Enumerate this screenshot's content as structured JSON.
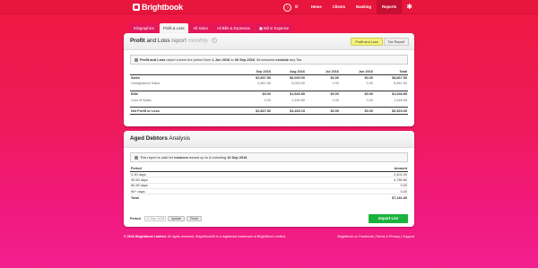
{
  "brand": {
    "name": "Brightbook"
  },
  "nav": {
    "items": [
      "Home",
      "Clients",
      "Banking",
      "Reports"
    ],
    "active": "Reports",
    "small_icon_label": "0"
  },
  "tabs": [
    {
      "label": "Infographics",
      "active": false
    },
    {
      "label": "Profit & Loss",
      "active": true
    },
    {
      "label": "All Sales",
      "active": false
    },
    {
      "label": "All Bills & Expenses",
      "active": false
    },
    {
      "label": "Bill or Expense",
      "active": false
    }
  ],
  "pl": {
    "title_bold": "Profit",
    "title_rest": " and Loss",
    "title_light": " report",
    "title_muted": " monthly",
    "btn_pl": "Profit and Loss",
    "btn_tax": "Tax Report",
    "info_pre": "Profit and Loss",
    "info_mid1": " report covers the period from ",
    "info_from": "1 Jun 2016",
    "info_mid2": " to ",
    "info_to": "30 Sep 2016",
    "info_mid3": ". All amounts ",
    "info_exclude": "exclude",
    "info_end": " any Tax.",
    "columns": [
      "Sep 2016",
      "Aug 2016",
      "Jul 2016",
      "Jun 2016",
      "Total"
    ],
    "rows": {
      "sales": {
        "label": "Sales",
        "values": [
          "$2,867.50",
          "$6,000.00",
          "$0.00",
          "$0.00",
          "$8,867.50"
        ]
      },
      "unreg": {
        "label": "Unregistered Sales",
        "values": [
          "2,867.50",
          "5,000.00",
          "0.00",
          "0.00",
          "8,867.50"
        ]
      },
      "bills": {
        "label": "Bills",
        "values": [
          "$0.00",
          "$1,546.85",
          "$0.00",
          "$0.00",
          "$1,546.85"
        ]
      },
      "cost": {
        "label": "Cost of Sales",
        "values": [
          "0.00",
          "1,546.85",
          "0.00",
          "0.00",
          "1,546.85"
        ]
      },
      "net": {
        "label": "Net Profit or Loss",
        "values": [
          "$2,867.50",
          "$4,453.15",
          "$0.00",
          "$0.00",
          "$6,520.65"
        ]
      }
    }
  },
  "ad": {
    "title_bold": "Aged Debtors",
    "title_rest": " Analysis",
    "info_pre": "This report is valid for ",
    "info_inv": "invoices",
    "info_mid": " issued up to & including ",
    "info_date": "12 Sep 2016",
    "info_end": ".",
    "col_period": "Period",
    "col_amount": "Amount",
    "rows": [
      {
        "period": "0-30 days",
        "amount": "2,401.00"
      },
      {
        "period": "30-60 days",
        "amount": "4,780.80"
      },
      {
        "period": "60-90 days",
        "amount": "0.00"
      },
      {
        "period": "90+ days",
        "amount": "0.00"
      }
    ],
    "total_label": "Total",
    "total_value": "$7,181.80",
    "period_label": "Period",
    "period_value": "12 Sep 2016",
    "update_btn": "Update",
    "reset_btn": "Reset",
    "export_btn": "Export List"
  },
  "footer": {
    "copyright": "© 2016 Brightbook Limited.",
    "rights": " All rights reserved.    BrightbookIM is a registered trademark of BrightBook Limited.",
    "links": "Brightbook on Facebook | Terms & Privacy | Support"
  }
}
